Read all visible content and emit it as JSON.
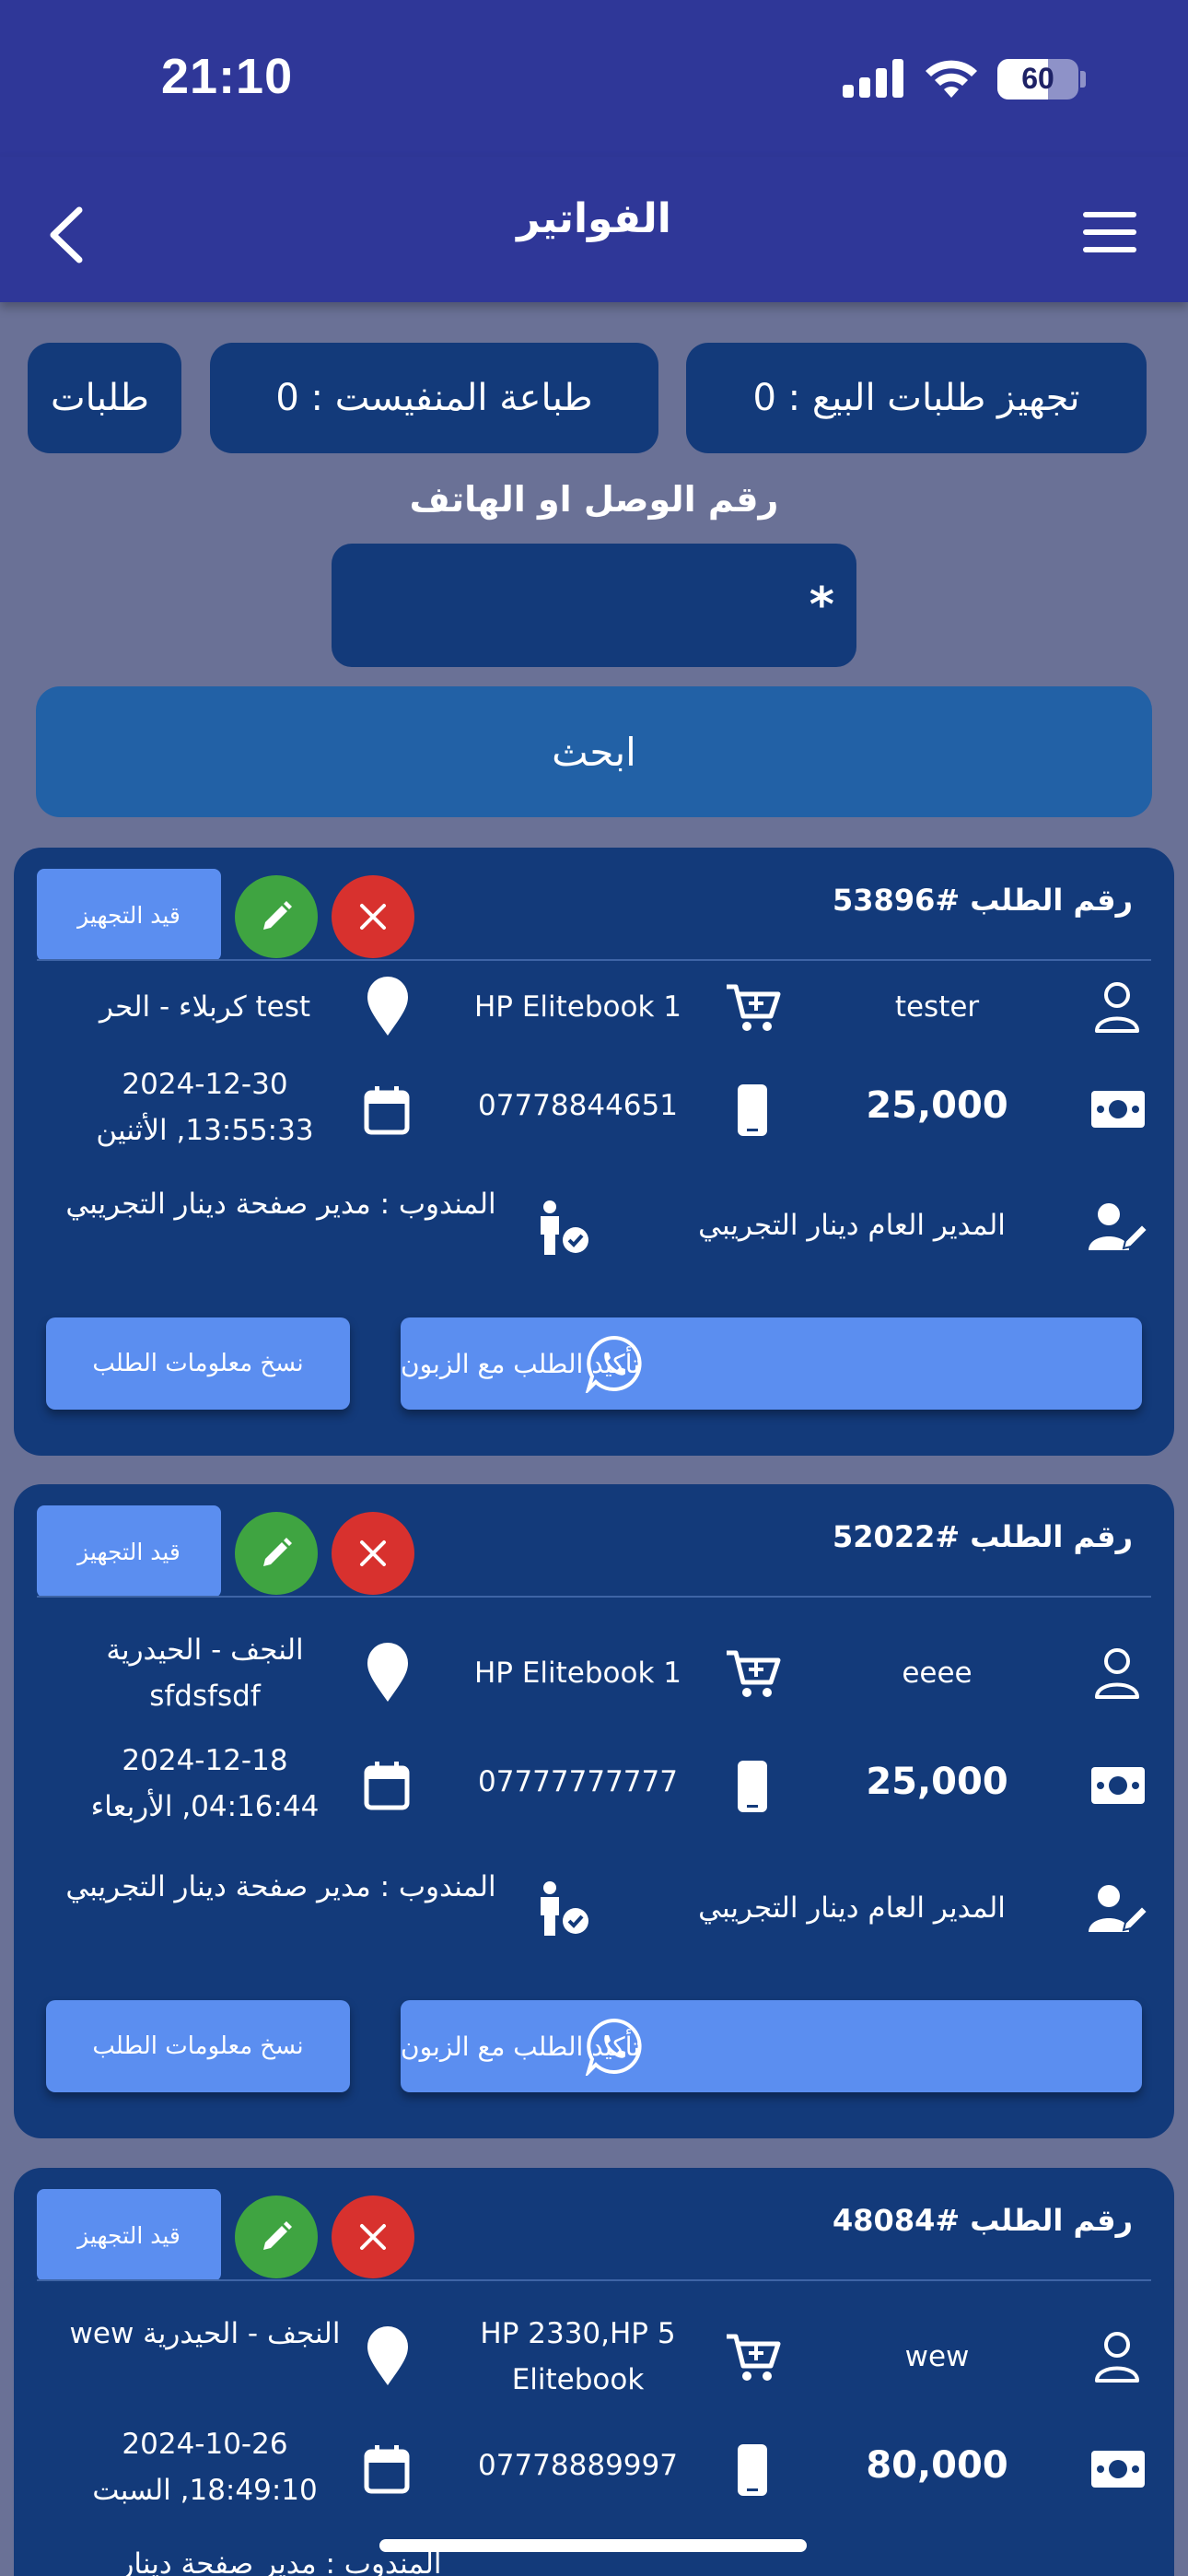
{
  "status_bar": {
    "time": "21:10",
    "battery": "60"
  },
  "header": {
    "title": "الفواتير"
  },
  "chips": [
    {
      "label": "تجهيز طلبات البيع : 0"
    },
    {
      "label": "طباعة المنفيست : 0"
    },
    {
      "label": "طلبات"
    }
  ],
  "search": {
    "label": "رقم الوصل او الهاتف",
    "value": "*",
    "button": "ابحث"
  },
  "orders": [
    {
      "order_no": "رقم الطلب #53896",
      "status": "قيد التجهيز",
      "customer": "tester",
      "product": "1 HP Elitebook",
      "location": "test كربلاء - الحر",
      "amount": "25,000",
      "phone": "07778844651",
      "date": "2024-12-30 13:55:33, الأثنين",
      "creator": "المدير العام دينار التجريبي",
      "delegate": "المندوب : مدير صفحة دينار التجريبي",
      "confirm_label": "تأكيد الطلب مع الزبون",
      "copy_label": "نسخ معلومات الطلب"
    },
    {
      "order_no": "رقم الطلب #52022",
      "status": "قيد التجهيز",
      "customer": "eeee",
      "product": "1 HP Elitebook",
      "location": "النجف - الحيدرية sfdsfsdf",
      "amount": "25,000",
      "phone": "07777777777",
      "date": "2024-12-18 04:16:44, الأربعاء",
      "creator": "المدير العام دينار التجريبي",
      "delegate": "المندوب : مدير صفحة دينار التجريبي",
      "confirm_label": "تأكيد الطلب مع الزبون",
      "copy_label": "نسخ معلومات الطلب"
    },
    {
      "order_no": "رقم الطلب #48084",
      "status": "قيد التجهيز",
      "customer": "wew",
      "product": "5 HP 2330,HP Elitebook",
      "location": "النجف - الحيدرية wew",
      "amount": "80,000",
      "phone": "07778889997",
      "date": "2024-10-26 18:49:10, السبت",
      "delegate": "المندوب : مدير صفحة دينار"
    }
  ],
  "colors": {
    "header": "#2f3798",
    "background": "#6a7196",
    "card": "#133a7a",
    "button": "#5b8ef0",
    "search_button": "#2261a6",
    "edit": "#3fa441",
    "delete": "#d8312e"
  }
}
